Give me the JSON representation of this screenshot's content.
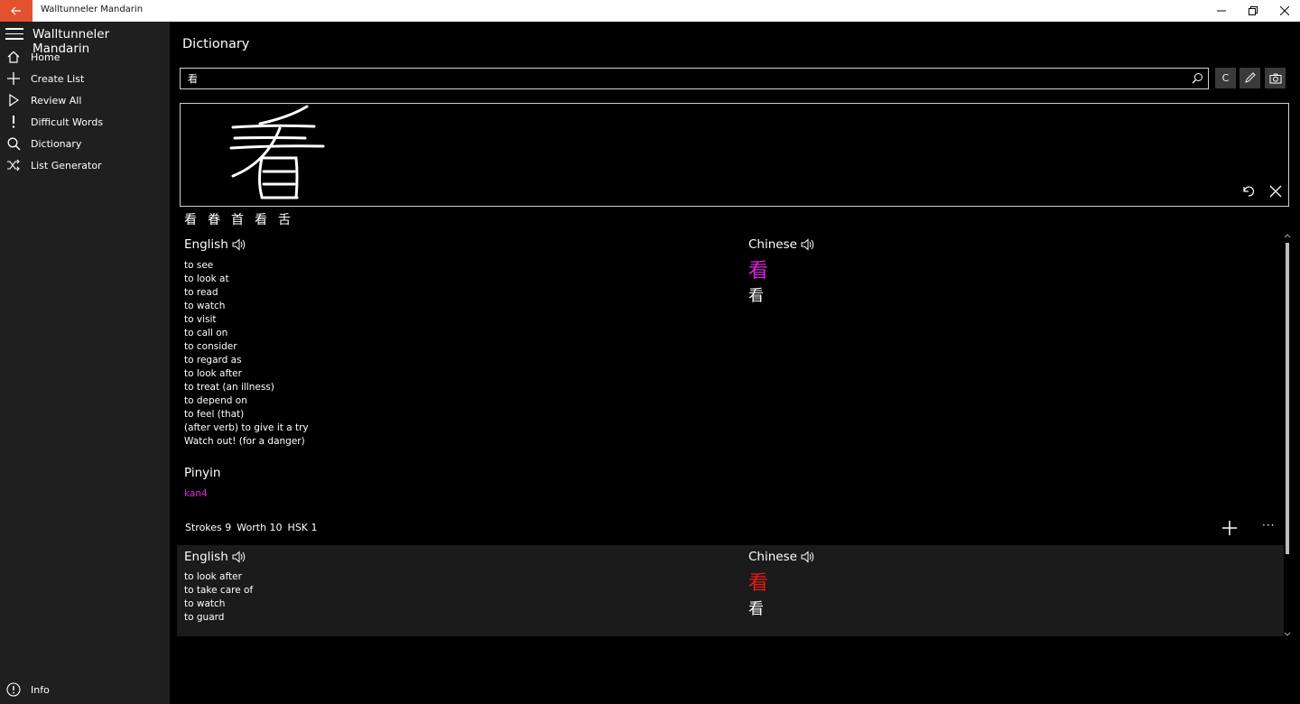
{
  "window": {
    "title": "Walltunneler Mandarin"
  },
  "sidebar": {
    "app_title": "Walltunneler Mandarin",
    "items": [
      {
        "label": "Home",
        "icon": "home-icon"
      },
      {
        "label": "Create List",
        "icon": "plus-icon"
      },
      {
        "label": "Review All",
        "icon": "play-icon"
      },
      {
        "label": "Difficult Words",
        "icon": "exclamation-icon"
      },
      {
        "label": "Dictionary",
        "icon": "search-icon"
      },
      {
        "label": "List Generator",
        "icon": "shuffle-icon"
      }
    ],
    "footer": {
      "label": "Info",
      "icon": "info-icon"
    }
  },
  "main": {
    "page_title": "Dictionary",
    "search": {
      "value": "看",
      "placeholder": ""
    },
    "tools": {
      "clear_label": "C"
    },
    "candidates": [
      "看",
      "眷",
      "首",
      "看",
      "舌"
    ],
    "entries": [
      {
        "english_header": "English",
        "chinese_header": "Chinese",
        "definitions": [
          "to see",
          "to look at",
          "to read",
          "to watch",
          "to visit",
          "to call on",
          "to consider",
          "to regard as",
          "to look after",
          "to treat (an illness)",
          "to depend on",
          "to feel (that)",
          "(after verb) to give it a try",
          "Watch out! (for a danger)"
        ],
        "hanzi_colored": "看",
        "hanzi_plain": "看",
        "tone_color": "#e020e0",
        "pinyin_header": "Pinyin",
        "pinyin": "kan4",
        "strokes": "Strokes 9",
        "worth": "Worth 10",
        "hsk": "HSK 1"
      },
      {
        "english_header": "English",
        "chinese_header": "Chinese",
        "definitions": [
          "to look after",
          "to take care of",
          "to watch",
          "to guard"
        ],
        "hanzi_colored": "看",
        "hanzi_plain": "看",
        "tone_color": "#e51b1b"
      }
    ]
  },
  "colors": {
    "accent": "#e2522e",
    "sidebar_bg": "#1f1f1f",
    "tone4": "#e020e0",
    "tone1": "#e51b1b"
  }
}
